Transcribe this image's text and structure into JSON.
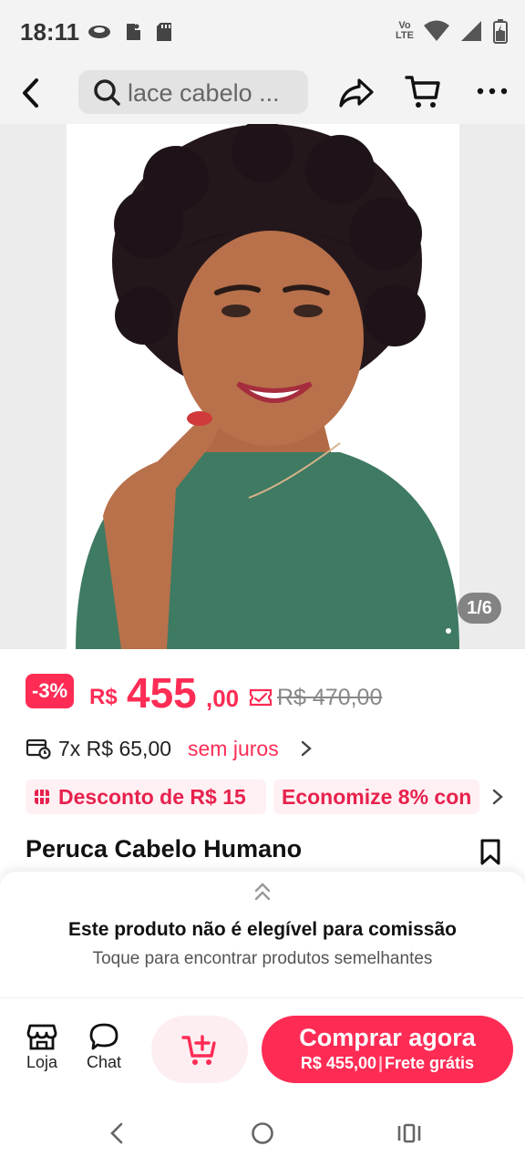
{
  "status_bar": {
    "time": "18:11",
    "network_label_top": "Vo",
    "network_label_bottom": "LTE",
    "icons": [
      "eye-icon",
      "dnd-icon",
      "sd-card-icon",
      "wifi-icon",
      "signal-icon",
      "battery-icon"
    ]
  },
  "header": {
    "search_text": "lace cabelo ...",
    "icons": [
      "back-arrow-icon",
      "search-icon",
      "share-icon",
      "cart-icon",
      "more-icon"
    ]
  },
  "gallery": {
    "page_indicator": "1/6",
    "current_image": 1,
    "total_images": 6
  },
  "price": {
    "discount_badge": "-3%",
    "currency": "R$",
    "amount_integer": "455",
    "amount_cents": ",00",
    "original_price": "R$ 470,00"
  },
  "installment": {
    "text": "7x R$ 65,00",
    "highlight": "sem juros"
  },
  "promos": [
    {
      "label": "Desconto de R$ 15"
    },
    {
      "label": "Economize 8% con"
    }
  ],
  "product": {
    "title": "Peruca Cabelo Humano"
  },
  "commission_sheet": {
    "title": "Este produto não é elegível para comissão",
    "subtitle": "Toque para encontrar produtos semelhantes"
  },
  "bottom_bar": {
    "shop_label": "Loja",
    "chat_label": "Chat",
    "buy_label": "Comprar agora",
    "buy_price": "R$ 455,00",
    "buy_separator": "|",
    "buy_shipping": "Frete grátis"
  },
  "colors": {
    "accent": "#fe2c55",
    "promo_background": "#fff0f3",
    "add_cart_background": "#fdeef1",
    "top_bar_background": "#f3f3f3"
  }
}
